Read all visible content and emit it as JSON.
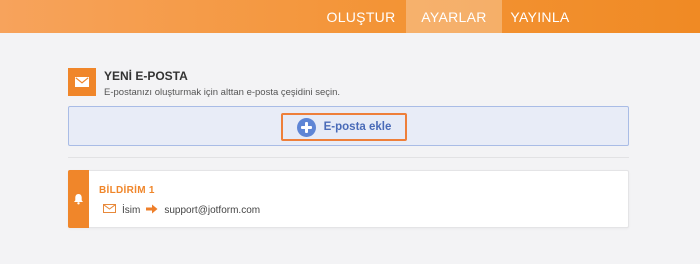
{
  "nav": {
    "tabs": [
      {
        "label": "OLUŞTUR"
      },
      {
        "label": "AYARLAR",
        "active": true
      },
      {
        "label": "YAYINLA"
      }
    ]
  },
  "new_email": {
    "title": "YENİ E-POSTA",
    "subtitle": "E-postanızı oluşturmak için alttan e-posta çeşidini seçin.",
    "add_button_label": "E-posta ekle"
  },
  "notification": {
    "title": "BİLDİRİM 1",
    "from": "İsim",
    "to": "support@jotform.com"
  },
  "colors": {
    "accent": "#f0862a",
    "add_button_text": "#4a6bb8",
    "add_box_bg": "#e8ecf7"
  },
  "icons": [
    "envelope-icon",
    "plus-circle-icon",
    "bell-icon",
    "arrow-right-icon"
  ]
}
